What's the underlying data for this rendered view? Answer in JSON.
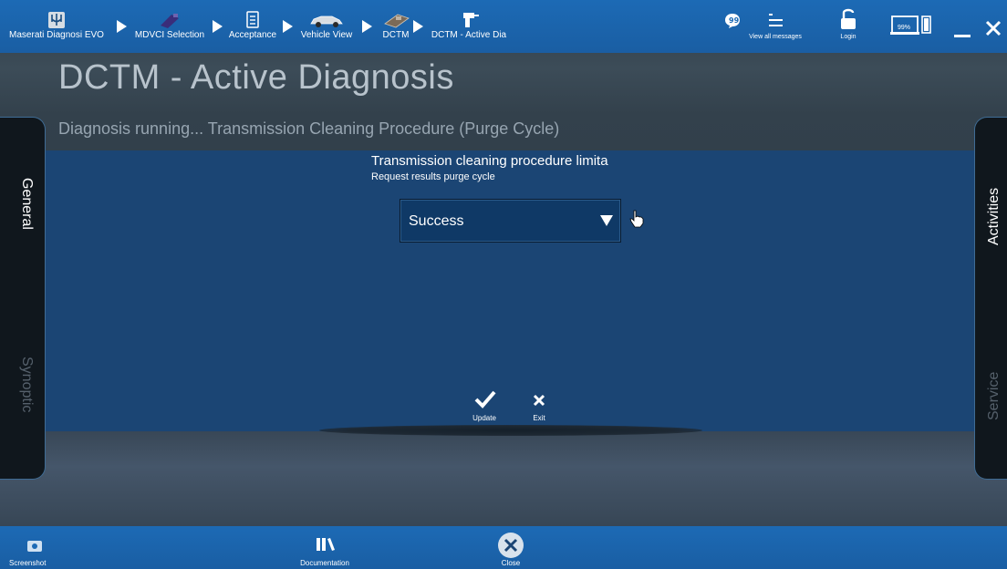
{
  "topbar": {
    "breadcrumbs": [
      {
        "label": "Maserati Diagnosi EVO",
        "icon": "trident-logo-icon"
      },
      {
        "label": "MDVCI Selection",
        "icon": "vci-device-icon"
      },
      {
        "label": "Acceptance",
        "icon": "document-list-icon"
      },
      {
        "label": "Vehicle View",
        "icon": "car-icon"
      },
      {
        "label": "DCTM",
        "icon": "ecu-module-icon"
      },
      {
        "label": "DCTM - Active Dia",
        "icon": "drill-tool-icon"
      }
    ],
    "messages_label": "View all messages",
    "login_label": "Login",
    "battery_label": "99%",
    "colors": {
      "bar": "#1c6ab5",
      "panel": "#1b4574"
    }
  },
  "page": {
    "title": "DCTM - Active Diagnosis",
    "subtitle": "Diagnosis running... Transmission Cleaning Procedure (Purge Cycle)"
  },
  "procedure": {
    "title": "Transmission cleaning procedure limita",
    "subtitle": "Request results purge cycle",
    "select_value": "Success",
    "update_label": "Update",
    "exit_label": "Exit"
  },
  "side_tabs": {
    "left": [
      "General",
      "Synoptic"
    ],
    "right": [
      "Activities",
      "Service"
    ]
  },
  "bottombar": {
    "screenshot_label": "Screenshot",
    "documentation_label": "Documentation",
    "close_label": "Close"
  }
}
